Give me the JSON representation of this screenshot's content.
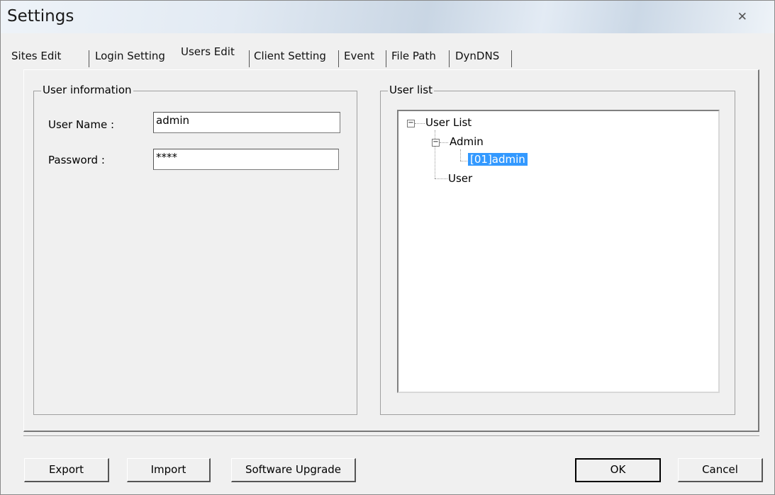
{
  "window": {
    "title": "Settings",
    "close_glyph": "✕"
  },
  "tabs": [
    {
      "label": "Sites Edit",
      "active": false
    },
    {
      "label": "Login Setting",
      "active": false
    },
    {
      "label": "Users Edit",
      "active": true
    },
    {
      "label": "Client Setting",
      "active": false
    },
    {
      "label": "Event",
      "active": false
    },
    {
      "label": "File Path",
      "active": false
    },
    {
      "label": "DynDNS",
      "active": false
    }
  ],
  "user_info": {
    "group_title": "User information",
    "username_label": "User Name :",
    "username_value": "admin",
    "password_label": "Password :",
    "password_value": "****"
  },
  "user_list": {
    "group_title": "User list",
    "root": "User List",
    "admin_group": "Admin",
    "admin_user": "[01]admin",
    "user_group": "User",
    "expand_glyph": "−"
  },
  "buttons": {
    "export": "Export",
    "import": "Import",
    "software_upgrade": "Software Upgrade",
    "ok": "OK",
    "cancel": "Cancel"
  },
  "colors": {
    "selection": "#3399ff",
    "face": "#f0f0f0"
  }
}
